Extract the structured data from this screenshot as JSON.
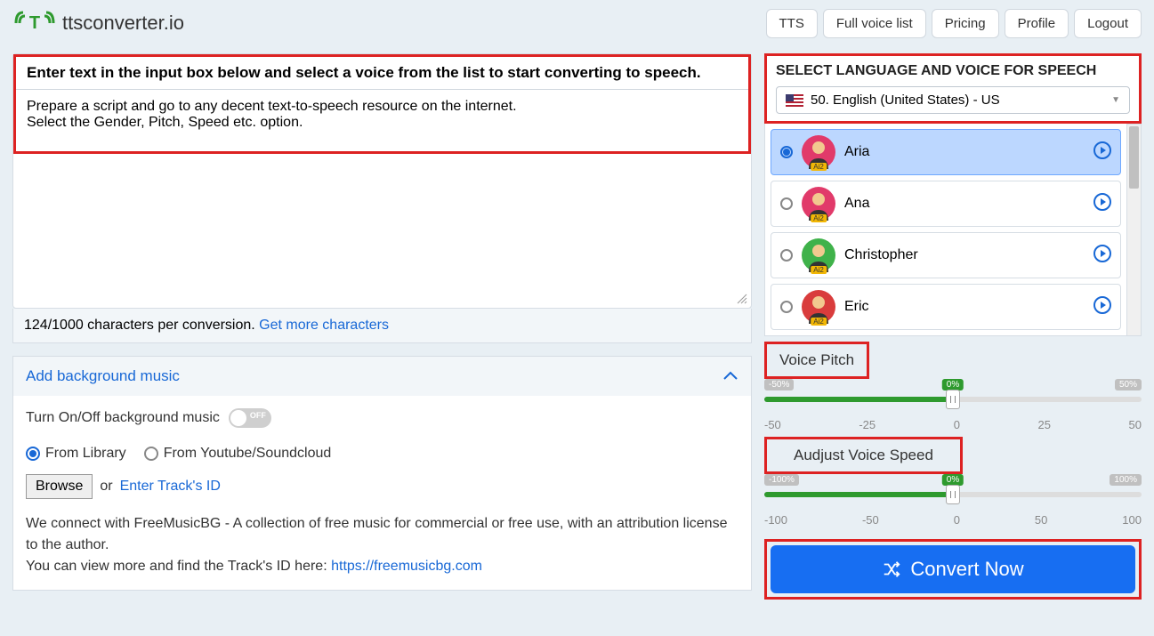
{
  "header": {
    "site_name": "ttsconverter.io",
    "nav": [
      "TTS",
      "Full voice list",
      "Pricing",
      "Profile",
      "Logout"
    ]
  },
  "input": {
    "label": "Enter text in the input box below and select a voice from the list to start converting to speech.",
    "text": "Prepare a script and go to any decent text-to-speech resource on the internet.\nSelect the Gender, Pitch, Speed etc. option.",
    "charcount_text": "124/1000 characters per conversion. ",
    "charcount_link": "Get more characters"
  },
  "music": {
    "title": "Add background music",
    "toggle_label": "Turn On/Off background music",
    "toggle_state": "OFF",
    "source_library": "From Library",
    "source_external": "From Youtube/Soundcloud",
    "browse": "Browse",
    "or": "or ",
    "enter_track": "Enter Track's ID",
    "desc1": "We connect with FreeMusicBG - A collection of free music for commercial or free use, with an attribution license to the author.",
    "desc2_prefix": "You can view more and find the Track's ID here: ",
    "desc2_link": "https://freemusicbg.com"
  },
  "voice_panel": {
    "title": "SELECT LANGUAGE AND VOICE FOR SPEECH",
    "selected_lang": "50. English (United States) - US",
    "voices": [
      {
        "name": "Aria",
        "selected": true,
        "avatar_color": "#e13a6a",
        "head_color": "#f2c98f"
      },
      {
        "name": "Ana",
        "selected": false,
        "avatar_color": "#e13a6a",
        "head_color": "#f2c98f"
      },
      {
        "name": "Christopher",
        "selected": false,
        "avatar_color": "#3fb24a",
        "head_color": "#f2c98f"
      },
      {
        "name": "Eric",
        "selected": false,
        "avatar_color": "#d93c3c",
        "head_color": "#f2c98f"
      }
    ],
    "ai_badge": "Ai2"
  },
  "pitch": {
    "label": "Voice Pitch",
    "min_badge": "-50%",
    "mid_badge": "0%",
    "max_badge": "50%",
    "ticks": [
      "-50",
      "-25",
      "0",
      "25",
      "50"
    ]
  },
  "speed": {
    "label": "Audjust Voice Speed",
    "min_badge": "-100%",
    "mid_badge": "0%",
    "max_badge": "100%",
    "ticks": [
      "-100",
      "-50",
      "0",
      "50",
      "100"
    ]
  },
  "convert_label": "Convert Now"
}
